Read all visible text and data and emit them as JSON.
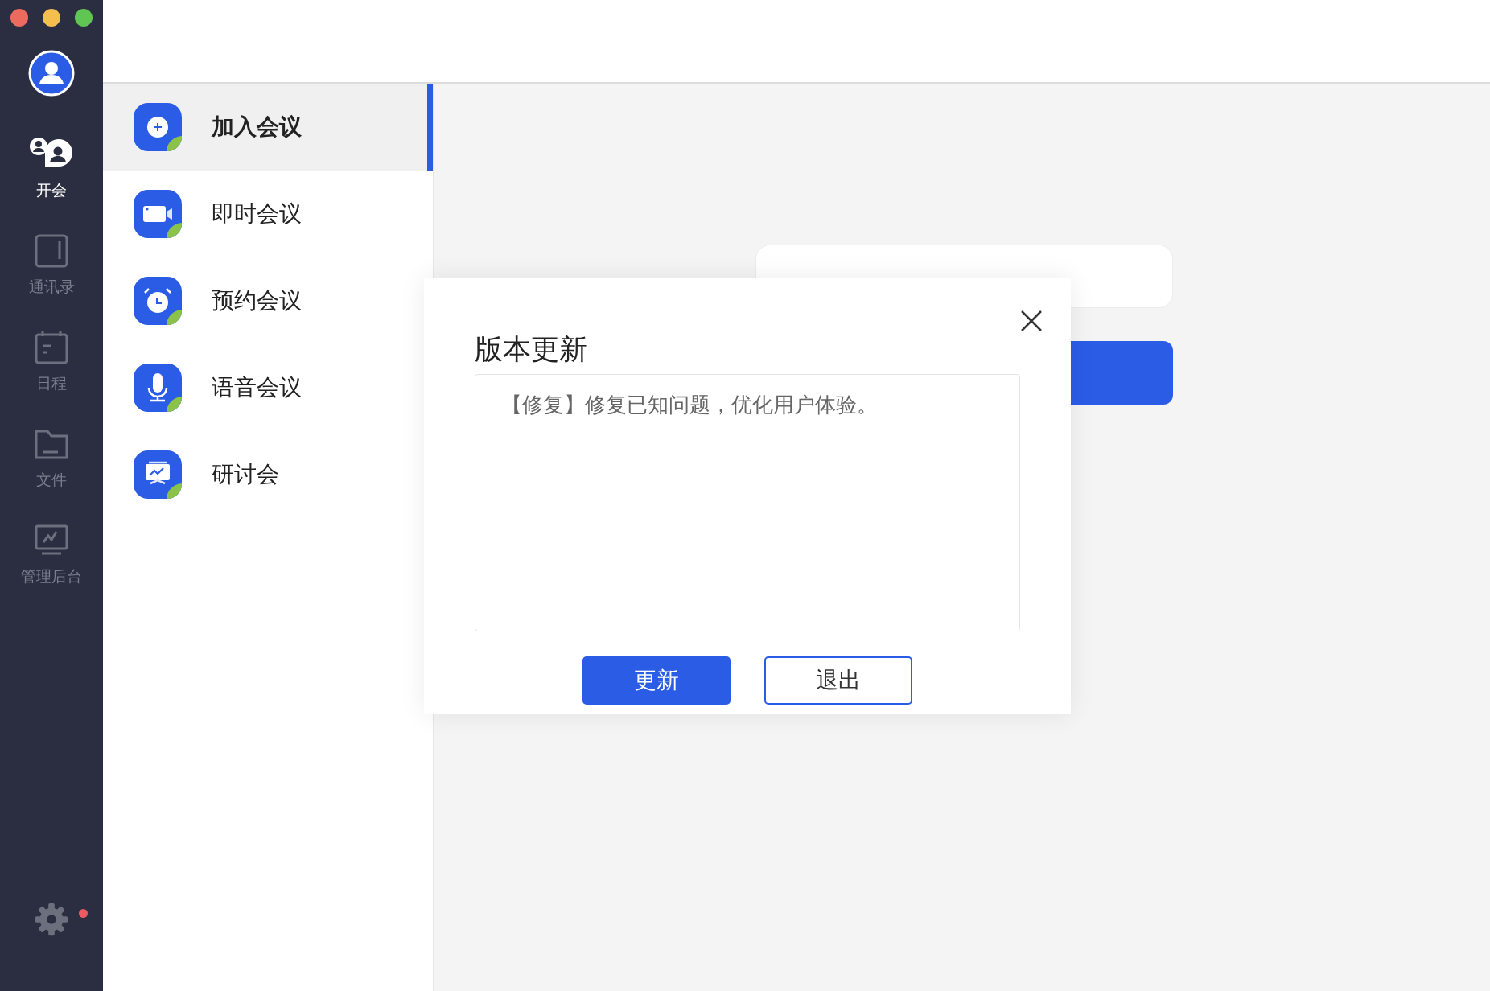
{
  "nav": [
    {
      "label": "开会",
      "selected": true
    },
    {
      "label": "通讯录",
      "selected": false
    },
    {
      "label": "日程",
      "selected": false
    },
    {
      "label": "文件",
      "selected": false
    },
    {
      "label": "管理后台",
      "selected": false
    }
  ],
  "settings": {
    "badge": true
  },
  "menu": [
    {
      "label": "加入会议",
      "selected": true
    },
    {
      "label": "即时会议",
      "selected": false
    },
    {
      "label": "预约会议",
      "selected": false
    },
    {
      "label": "语音会议",
      "selected": false
    },
    {
      "label": "研讨会",
      "selected": false
    }
  ],
  "join": {
    "kind": "field"
  },
  "dialog": {
    "title": "版本更新",
    "notes": "【修复】修复已知问题，优化用户体验。",
    "buttons": [
      {
        "label": "更新",
        "kind": "primary"
      },
      {
        "label": "退出",
        "kind": "secondary"
      }
    ]
  }
}
